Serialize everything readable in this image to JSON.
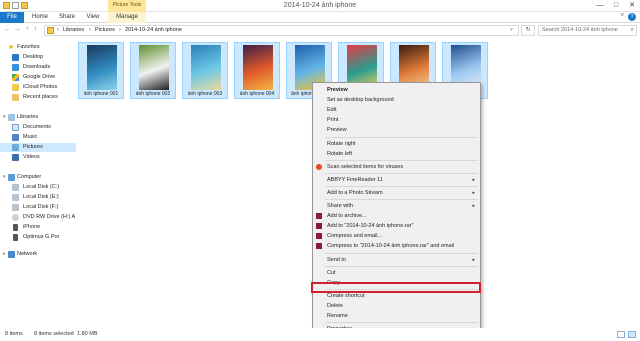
{
  "window": {
    "title": "2014-10-24 ảnh iphone",
    "contextual_tab": "Picture Tools",
    "controls": {
      "minimize": "—",
      "maximize": "□",
      "close": "✕"
    }
  },
  "ribbon": {
    "tabs": [
      "File",
      "Home",
      "Share",
      "View",
      "Manage"
    ],
    "help": "?"
  },
  "address": {
    "back": "←",
    "forward": "→",
    "up": "↑",
    "crumbs": [
      "Libraries",
      "Pictures",
      "2014-10-24 ảnh iphone"
    ],
    "separator": "›",
    "refresh": "↻",
    "search_placeholder": "Search 2014-10-24 ảnh iphone",
    "search_icon": "search-icon"
  },
  "nav": {
    "favorites": {
      "label": "Favorites",
      "items": [
        "Desktop",
        "Downloads",
        "Google Drive",
        "iCloud Photos",
        "Recent places"
      ]
    },
    "libraries": {
      "label": "Libraries",
      "items": [
        "Documents",
        "Music",
        "Pictures",
        "Videos"
      ],
      "selected": "Pictures"
    },
    "computer": {
      "label": "Computer",
      "items": [
        "Local Disk (C:)",
        "Local Disk (E:)",
        "Local Disk (F:)",
        "DVD RW Drive (H:) A",
        "iPhone",
        "Optimus G Pro"
      ]
    },
    "network": {
      "label": "Network"
    }
  },
  "files": [
    {
      "name": "ảnh iphone 001",
      "palette": [
        "#1a3a5c",
        "#2e8bc0",
        "#8fd3e8"
      ]
    },
    {
      "name": "ảnh iphone 002",
      "palette": [
        "#5c8f2a",
        "#f2f2f2",
        "#1b1b1b"
      ]
    },
    {
      "name": "ảnh iphone 003",
      "palette": [
        "#2a7fb8",
        "#6cc7e6",
        "#e8d9a0"
      ]
    },
    {
      "name": "ảnh iphone 004",
      "palette": [
        "#3b1f4a",
        "#e05a2a",
        "#f2b544"
      ]
    },
    {
      "name": "ảnh iphone",
      "palette": [
        "#1d5fa8",
        "#63b5e8",
        "#f4c430"
      ]
    },
    {
      "name": "",
      "palette": [
        "#e63946",
        "#2a9d8f",
        "#f4d35e"
      ]
    },
    {
      "name": "",
      "palette": [
        "#3a1c0f",
        "#e07b39",
        "#f5d6a0"
      ]
    },
    {
      "name": "",
      "palette": [
        "#1f4e8c",
        "#9cc8f0",
        "#e9eef5"
      ]
    }
  ],
  "context_menu": {
    "items": [
      {
        "label": "Preview",
        "bold": true
      },
      {
        "label": "Set as desktop background"
      },
      {
        "label": "Edit"
      },
      {
        "label": "Print"
      },
      {
        "label": "Preview"
      },
      {
        "sep": true
      },
      {
        "label": "Rotate right"
      },
      {
        "label": "Rotate left"
      },
      {
        "sep": true
      },
      {
        "label": "Scan selected items for viruses",
        "icon": "antivirus-icon",
        "icon_color": "#e64a19"
      },
      {
        "sep": true
      },
      {
        "label": "ABBYY FineReader 11",
        "submenu": true
      },
      {
        "sep": true
      },
      {
        "label": "Add to a Photo Stream",
        "submenu": true
      },
      {
        "sep": true
      },
      {
        "label": "Share with",
        "submenu": true
      },
      {
        "label": "Add to archive...",
        "icon": "winrar-icon",
        "icon_color": "#8b1d3a"
      },
      {
        "label": "Add to \"2014-10-24 ảnh iphone.rar\"",
        "icon": "winrar-icon",
        "icon_color": "#8b1d3a"
      },
      {
        "label": "Compress and email...",
        "icon": "winrar-icon",
        "icon_color": "#8b1d3a"
      },
      {
        "label": "Compress to \"2014-10-24 ảnh iphone.rar\" and email",
        "icon": "winrar-icon",
        "icon_color": "#8b1d3a"
      },
      {
        "sep": true
      },
      {
        "label": "Send to",
        "submenu": true
      },
      {
        "sep": true
      },
      {
        "label": "Cut"
      },
      {
        "label": "Copy",
        "highlighted": true
      },
      {
        "sep": true
      },
      {
        "label": "Create shortcut"
      },
      {
        "label": "Delete"
      },
      {
        "label": "Rename"
      },
      {
        "sep": true
      },
      {
        "label": "Properties"
      }
    ],
    "submenu_arrow": "▸"
  },
  "status": {
    "count": "8 items",
    "selection": "8 items selected",
    "size": "1.80 MB"
  },
  "colors": {
    "accent": "#1979ca",
    "selection_fill": "#cce8ff",
    "selection_border": "#99d1ff",
    "highlight_box": "#d4202e",
    "contextual_tab": "#fbe69a"
  }
}
